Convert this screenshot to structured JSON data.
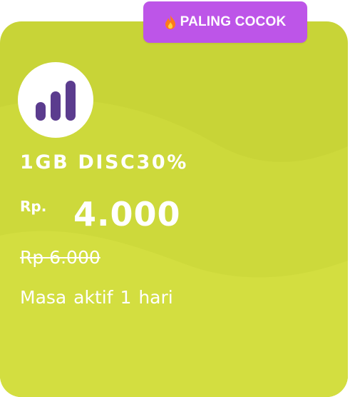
{
  "badge": {
    "icon": "fire-icon",
    "label": "PALING COCOK",
    "color": "#bd55e8"
  },
  "card": {
    "background": "#c8d437",
    "accent": "#d6e042",
    "logo_icon": "signal-bars-icon",
    "logo_color": "#5b3c8e",
    "plan_name": "1GB DISC30%",
    "currency": "Rp.",
    "price": "4.000",
    "original_price": "Rp 6.000",
    "validity": "Masa aktif 1 hari"
  }
}
